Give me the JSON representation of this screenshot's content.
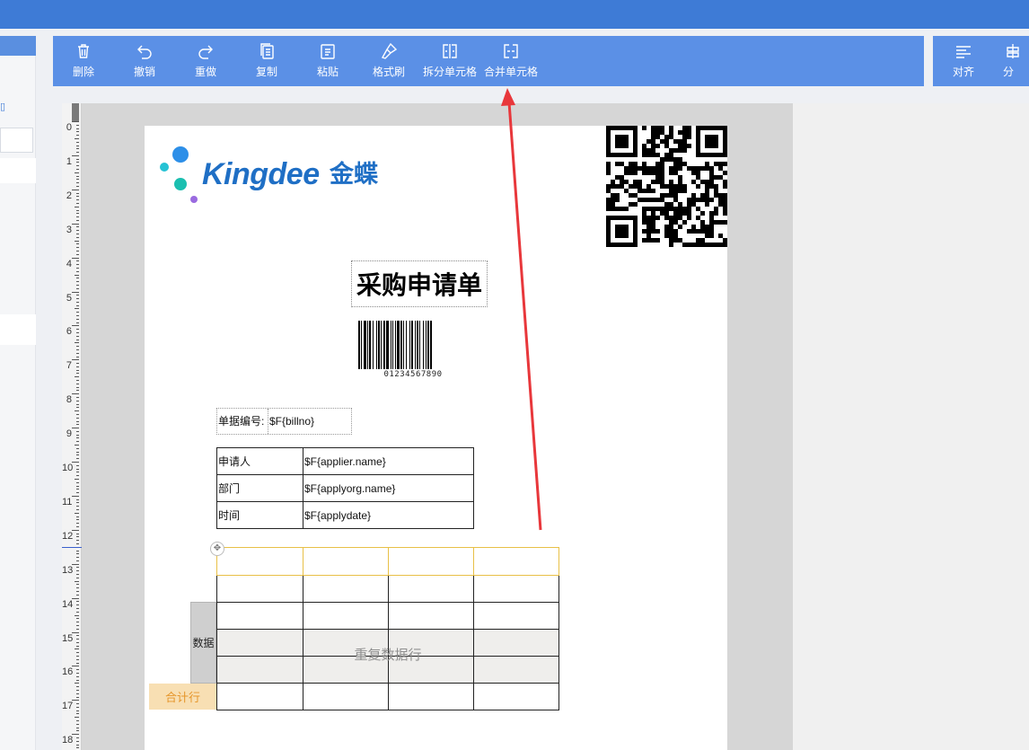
{
  "toolbar": {
    "tools": [
      {
        "label": "删除",
        "icon": "trash-icon"
      },
      {
        "label": "撤销",
        "icon": "undo-icon"
      },
      {
        "label": "重做",
        "icon": "redo-icon"
      },
      {
        "label": "复制",
        "icon": "copy-icon"
      },
      {
        "label": "粘贴",
        "icon": "paste-icon"
      },
      {
        "label": "格式刷",
        "icon": "format-brush-icon"
      },
      {
        "label": "拆分单元格",
        "icon": "split-cells-icon"
      },
      {
        "label": "合并单元格",
        "icon": "merge-cells-icon"
      }
    ],
    "right_tools": [
      {
        "label": "对齐",
        "icon": "align-icon"
      },
      {
        "label": "分",
        "icon": "distribute-icon"
      }
    ]
  },
  "ruler": {
    "numbers": [
      "0",
      "1",
      "2",
      "3",
      "4",
      "5",
      "6",
      "7",
      "8",
      "9",
      "10",
      "11",
      "12",
      "13",
      "14",
      "15",
      "16",
      "17",
      "18"
    ]
  },
  "document": {
    "logo_text": "Kingdee",
    "logo_cn": "金蝶",
    "title": "采购申请单",
    "barcode_number": "01234567890",
    "billno_label": "单据编号:",
    "billno_value": "$F{billno}",
    "info_rows": [
      {
        "label": "申请人",
        "value": "$F{applier.name}"
      },
      {
        "label": "部门",
        "value": "$F{applyorg.name}"
      },
      {
        "label": "时间",
        "value": "$F{applydate}"
      }
    ],
    "repeat_row_label": "重复数据行",
    "data_tag": "数据",
    "sum_row_tag": "合计行"
  },
  "colors": {
    "top_bar": "#3e7bd6",
    "toolbar": "#5b90e6",
    "annotation_arrow": "#e8373b",
    "sum_tag_bg": "#f8dfb3",
    "sum_tag_text": "#e6962b",
    "selection": "#e8c047"
  }
}
